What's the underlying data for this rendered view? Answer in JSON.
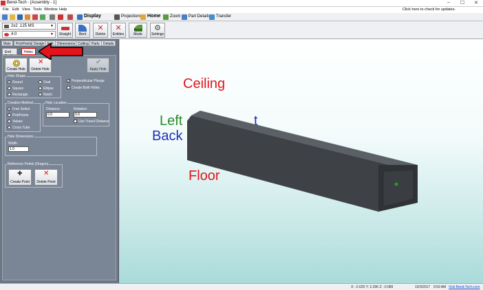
{
  "window": {
    "title": "Bend-Tech - [Assembly - 1]",
    "minimize": "–",
    "maximize": "☐",
    "close": "✕"
  },
  "menu": {
    "items": [
      "File",
      "Edit",
      "View",
      "Tools",
      "Window",
      "Help"
    ],
    "update": "Click here to check for updates."
  },
  "toolbar": {
    "display": "Display",
    "projections": "Projections",
    "home": "Home",
    "zoom": "Zoom",
    "part_details": "Part Details",
    "transfer": "Transfer"
  },
  "selectors": {
    "material": "2x2 .125 MS",
    "radius": "4.0"
  },
  "tool_buttons": {
    "straight": "Straight",
    "bent": "Bent",
    "delete": "Delete",
    "entities": "Entities",
    "bend_mode": "Bend Mode",
    "settings": "Settings"
  },
  "tabs": [
    "Main",
    "PickPoints",
    "Design",
    "Edit",
    "Dimensions",
    "Cutting",
    "Parts",
    "Details"
  ],
  "subtabs": {
    "end_profile": "End Profile",
    "holes": "Holes"
  },
  "hole_buttons": {
    "create": "Create Hole",
    "delete": "Delete Hole",
    "apply": "Apply Hole"
  },
  "hole_shape": {
    "title": "Hole Shape",
    "round": "Round",
    "square": "Square",
    "rectangle": "Rectangle",
    "oval": "Oval",
    "ellipse": "Ellipse",
    "notch": "Notch",
    "perpendicular": "Perpendicular Plunge",
    "create_both": "Create Both Holes"
  },
  "creation": {
    "title": "Creation Method",
    "free": "Free Select",
    "pick": "PickPoints",
    "values": "Values",
    "cross": "Cross Tube"
  },
  "location": {
    "title": "Hole Location",
    "distance_label": "Distance:",
    "distance": "0.0",
    "rotation_label": "Rotation:",
    "rotation": "0.0",
    "travel": "Use Travel Distance"
  },
  "dimensions": {
    "title": "Hole Dimensions",
    "width_label": "Width:",
    "width": "1.0"
  },
  "reference": {
    "title": "Reference Points (Dragon)",
    "create": "Create Point",
    "delete": "Delete Point"
  },
  "viewport": {
    "ceiling": "Ceiling",
    "left": "Left",
    "back": "Back",
    "floor": "Floor",
    "right_partial": "t"
  },
  "status": {
    "coords": "X: -2.625  Y: 2.296  Z: -0.089",
    "date": "10/3/2017",
    "time": "9:59 AM",
    "link": "Visit Bend-Tech.com"
  },
  "colors": {
    "ceiling": "#e0161b",
    "floor": "#e0161b",
    "left": "#2a8a28",
    "back": "#1f31b9",
    "tube": "#3e4246",
    "arrow": "#e5141a",
    "panel": "#6b7686"
  }
}
